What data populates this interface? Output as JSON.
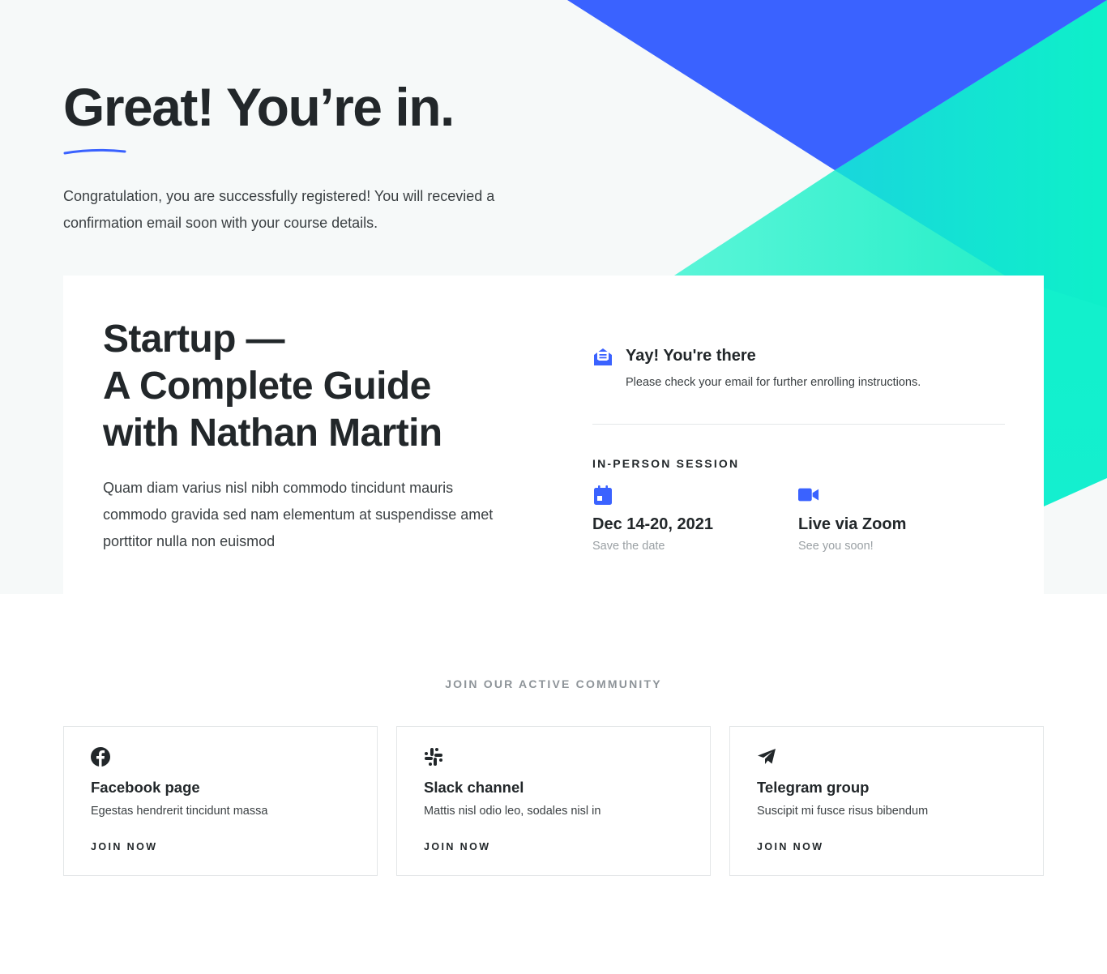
{
  "hero": {
    "title": "Great! You’re in.",
    "text": "Congratulation, you are successfully registered! You will recevied a confirmation email soon with your course details."
  },
  "course": {
    "title": "Startup —\nA Complete Guide\nwith Nathan Martin",
    "description": "Quam diam varius nisl nibh commodo tincidunt mauris commodo gravida sed nam elementum at suspendisse amet porttitor nulla non euismod"
  },
  "notice": {
    "icon": "email-open-icon",
    "title": "Yay! You're there",
    "text": "Please check your email for further enrolling instructions."
  },
  "session": {
    "label": "IN-PERSON SESSION",
    "items": [
      {
        "icon": "calendar-icon",
        "title": "Dec 14-20, 2021",
        "subtitle": "Save the date"
      },
      {
        "icon": "video-camera-icon",
        "title": "Live via Zoom",
        "subtitle": "See you soon!"
      }
    ]
  },
  "community": {
    "title": "JOIN OUR ACTIVE COMMUNITY",
    "cards": [
      {
        "icon": "facebook-icon",
        "title": "Facebook page",
        "description": "Egestas hendrerit tincidunt massa",
        "button": "JOIN NOW"
      },
      {
        "icon": "slack-icon",
        "title": "Slack channel",
        "description": "Mattis nisl odio leo, sodales nisl in",
        "button": "JOIN NOW"
      },
      {
        "icon": "telegram-icon",
        "title": "Telegram group",
        "description": "Suscipit mi fusce risus bibendum",
        "button": "JOIN NOW"
      }
    ]
  },
  "colors": {
    "accent_blue": "#3a62ff",
    "accent_green": "#0ef2c8",
    "text_dark": "#22272a",
    "muted": "#9aa0a4"
  }
}
